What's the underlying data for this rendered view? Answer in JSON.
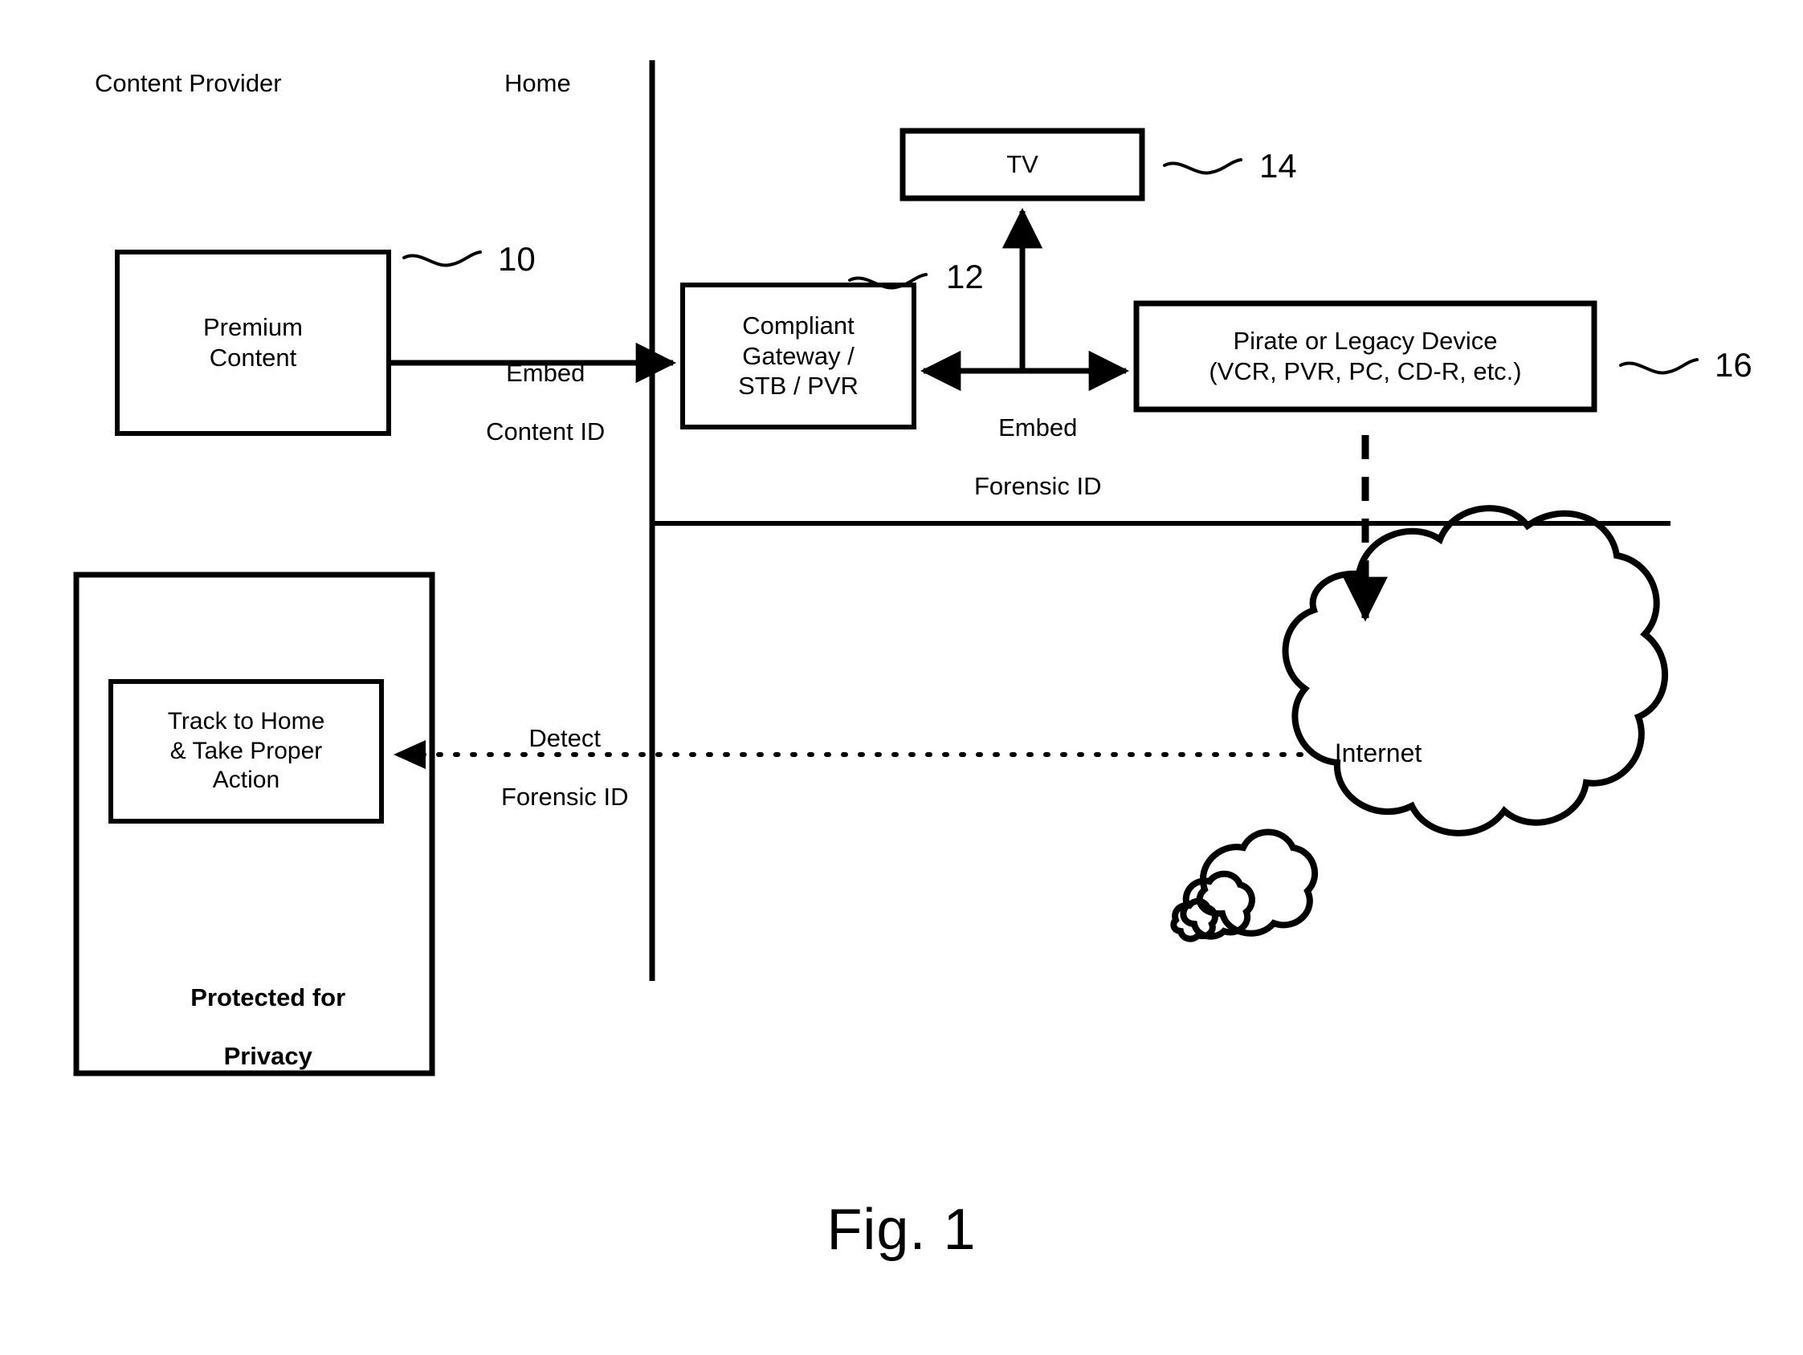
{
  "figure": {
    "caption": "Fig. 1",
    "sections": {
      "left": "Content Provider",
      "right": "Home"
    },
    "boxes": [
      {
        "id": "premium-content",
        "lines": [
          "Premium",
          "Content"
        ],
        "ref": "10"
      },
      {
        "id": "compliant-gateway",
        "lines": [
          "Compliant",
          "Gateway /",
          "STB / PVR"
        ],
        "ref": "12"
      },
      {
        "id": "tv",
        "lines": [
          "TV"
        ],
        "ref": "14"
      },
      {
        "id": "pirate-legacy-device",
        "lines": [
          "Pirate or Legacy Device",
          "(VCR, PVR, PC, CD-R, etc.)"
        ],
        "ref": "16"
      },
      {
        "id": "track-to-home",
        "lines": [
          "Track to Home",
          "& Take Proper",
          "Action"
        ],
        "ref": ""
      }
    ],
    "privacy_note": [
      "Protected for",
      "Privacy"
    ],
    "cloud_label": "Internet",
    "arrow_labels": {
      "embed_content_id": [
        "Embed",
        "Content ID"
      ],
      "embed_forensic_id": [
        "Embed",
        "Forensic ID"
      ],
      "detect_forensic_id": [
        "Detect",
        "Forensic ID"
      ]
    },
    "ref_numbers": {
      "premium_content": "10",
      "compliant_gateway": "12",
      "tv": "14",
      "pirate_device": "16"
    },
    "colors": {
      "ink": "#000000",
      "paper": "#ffffff"
    }
  }
}
